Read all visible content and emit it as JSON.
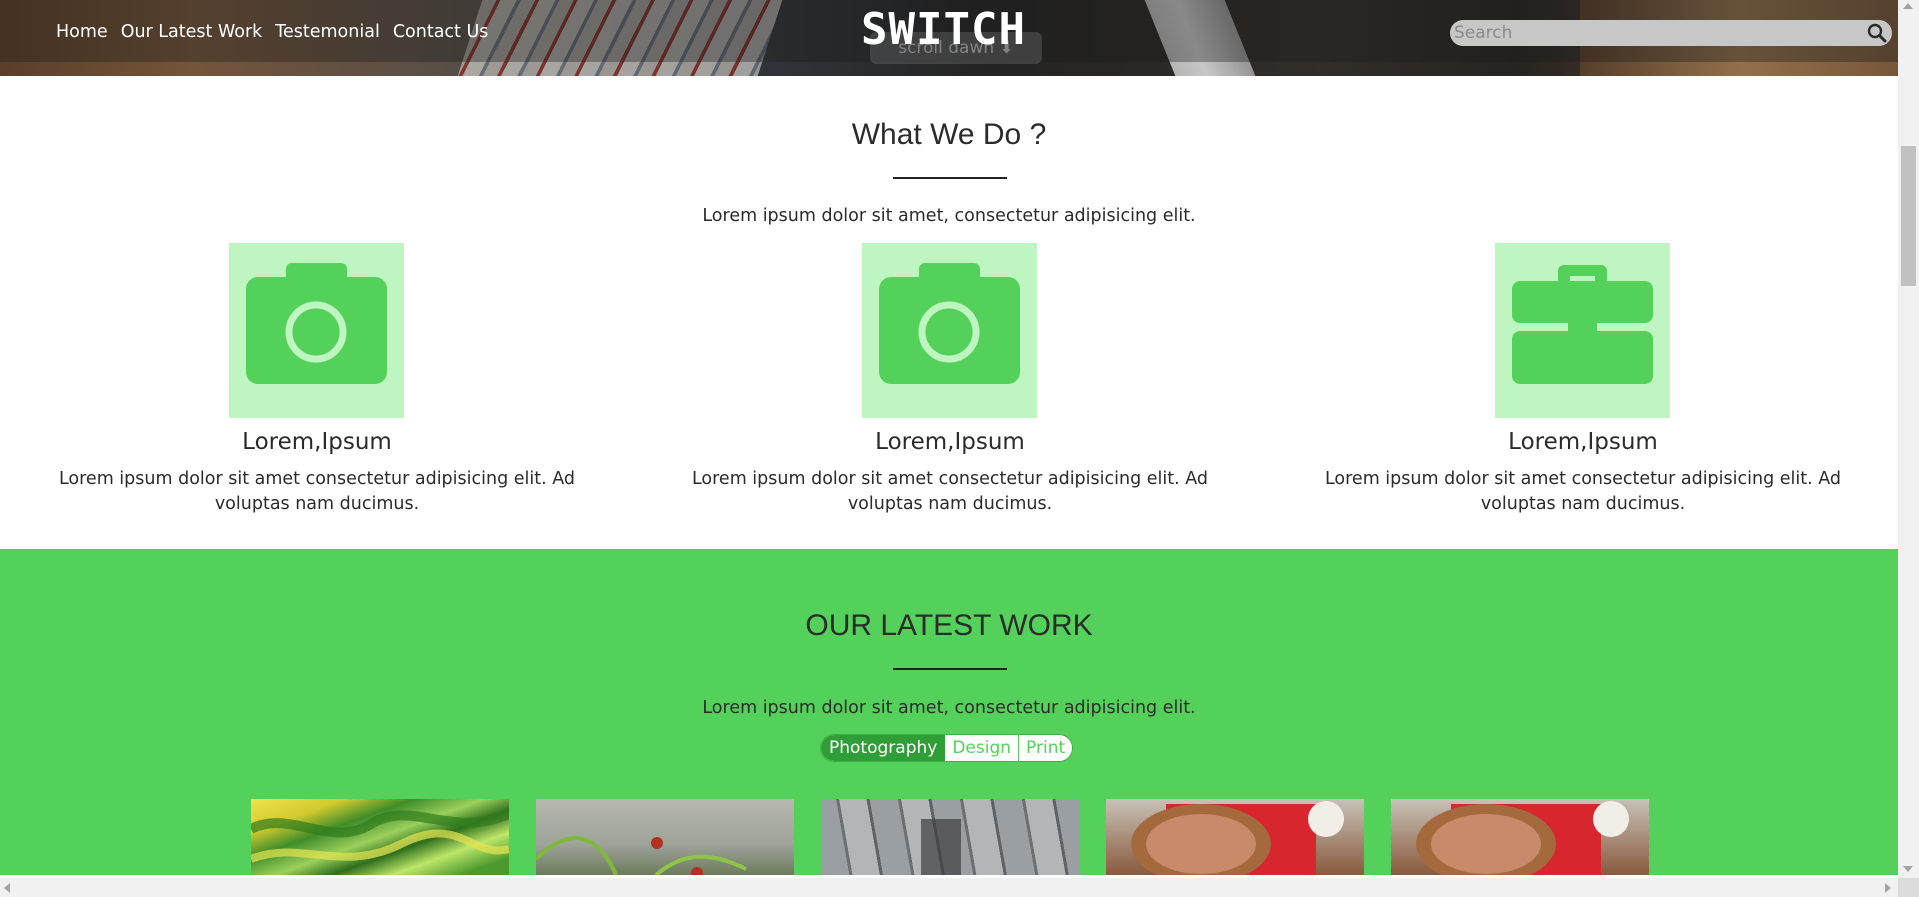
{
  "header": {
    "nav": [
      "Home",
      "Our Latest Work",
      "Testemonial",
      "Contact Us"
    ],
    "logo": "SWITCH",
    "scroll_button": "scroll dawn ⬇",
    "search_placeholder": "Search"
  },
  "what_we_do": {
    "title": "What We Do ?",
    "subtitle": "Lorem ipsum dolor sit amet, consectetur adipisicing elit.",
    "services": [
      {
        "icon": "camera-icon",
        "title": "Lorem,Ipsum",
        "text": "Lorem ipsum dolor sit amet consectetur adipisicing elit. Ad voluptas nam ducimus."
      },
      {
        "icon": "camera-icon",
        "title": "Lorem,Ipsum",
        "text": "Lorem ipsum dolor sit amet consectetur adipisicing elit. Ad voluptas nam ducimus."
      },
      {
        "icon": "briefcase-icon",
        "title": "Lorem,Ipsum",
        "text": "Lorem ipsum dolor sit amet consectetur adipisicing elit. Ad voluptas nam ducimus."
      }
    ]
  },
  "latest_work": {
    "title": "OUR LATEST WORK",
    "subtitle": "Lorem ipsum dolor sit amet, consectetur adipisicing elit.",
    "filters": [
      "Photography",
      "Design",
      "Print"
    ],
    "active_filter": "Photography",
    "thumbnails": [
      "green-abstract-photo",
      "ladybug-photo",
      "boardwalk-photo",
      "pizza-photo",
      "pizza-photo"
    ]
  },
  "colors": {
    "accent_green": "#54d15a",
    "icon_box": "#bff5c1",
    "active_filter": "#2f9e37"
  }
}
